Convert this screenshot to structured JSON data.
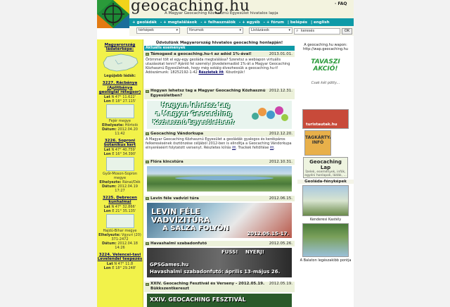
{
  "header": {
    "site_name": "geocaching.hu",
    "tagline": "A Magyar Geocaching Közhasznú Egyesület hivatalos lapja",
    "faq": "· FAQ"
  },
  "nav": {
    "items": [
      "+ geoládák",
      "- + megtalálások",
      "- + felhasználók",
      "- + egyéb",
      "- + fórum",
      "| belépés",
      "| english"
    ]
  },
  "filters": {
    "map_select": "térképek",
    "forum_select": "fórumok",
    "list_select": "Listázások",
    "search_placeholder": "keresés",
    "ok_label": "OK"
  },
  "left": {
    "header": "Magyarország ládatérképe:",
    "latest_label": "Legújabb ládák:",
    "caches": [
      {
        "title": "3227. Rácbánya (Aplitbánya geológiai rétegsor)",
        "lat": "N 47° 11.622'",
        "lon": "E 18° 27.115'",
        "county": "Fejér megye",
        "place": "Hőrtoló",
        "date": "2012.04.20 11:42"
      },
      {
        "title": "3226. Soproni botanikus kert",
        "lat": "N 47° 40.759'",
        "lon": "E 16° 34.390'",
        "county": "Győr-Moson-Sopron megye",
        "place": "Ránai/Dék",
        "date": "2012.04.19 17:27"
      },
      {
        "title": "3225. Debrecen kunhalmai",
        "lat": "N 47° 32.866'",
        "lon": "E 21° 35.135'",
        "county": "Hajdú-Bihar megye",
        "place": "Vgyuri (20) 371-2472",
        "date": "2012.04.18 14:26"
      },
      {
        "title": "3224. Velencei-tavi Levelendei teepezés",
        "lat": "N 47° 11.8 ",
        "lon": "E 18° 29.248'",
        "county": "",
        "place": "",
        "date": ""
      }
    ],
    "lat_prefix": "Lat",
    "lon_prefix": "Lon",
    "place_label": "Elhelyezte:",
    "date_label": "Dátum:"
  },
  "center": {
    "welcome": "Üdvözlünk Magyarország hivatalos geocaching honlapján!",
    "section": "Aktuális események",
    "news": [
      {
        "title": "Támogasd a geocaching.hu-t az adód 1%-ával!",
        "date": "2013.01.01.",
        "body": "Örömmel tölt el egy-egy geoláda megtalálása? Szeretsz a webiapon virtuális utazásokat tenni? Ajánld fel személyi jövedelemadód 1%-át a Magyar Geocaching Közhasznú Egyesületnek, hogy még sokáig élvezhessük a geocaching.hu-t! Adószámunk: 18252192-1-42",
        "link": "Részletek itt",
        "suffix": ". Köszönjük!"
      },
      {
        "title": "Hogyan lehetsz tag a Magyar Geocaching Közhasznú Egyesületben?",
        "date": "2012.12.31.",
        "banner1": "Hogyan lehetsz tag",
        "banner2": "a Magyar Geocaching",
        "banner3": "Közhasznú Egyesületben?"
      },
      {
        "title": "Geocaching Vándorkupa",
        "date": "2012.12.20.",
        "body": "A Magyar Geocaching Közhasznú Egyesület a geoládák gyalogos és kerékpáros felkeresésének ösztönzése céljából 2012-ben is elindítja a Geocaching Vándorkupa elnyeréséért folytatott versenyt. Részletes kiírás",
        "link": "itt",
        "suffix": ". Trackek feltöltése",
        "link2": "itt",
        "end": "."
      },
      {
        "title": "Flóra kincstúra",
        "date": "2012.10.31."
      },
      {
        "title": "Levin féle vadvízi túra",
        "date": "2012.06.15.",
        "banner1": "LEVIN FÉLE",
        "banner2": "VADVÍZITÚRA",
        "banner3": "A SALZA FOLYÓN",
        "banner4": "2012.06.15-17."
      },
      {
        "title": "Havashalmi szabadonfutó",
        "date": "2012.05.26.",
        "banner1": "FUSS!",
        "banner2": "NYERJ!",
        "banner3": "GPSGames.hu",
        "banner4": "Havashalmi szabadonfutó: április 13-május 26."
      },
      {
        "title": "XXIV. Geocaching Fesztivál és Verseny - 2012.05.19. Bükkszentkereszt",
        "date": "2012.05.19.",
        "banner1": "XXIV. GEOCACHING FESZTIVÁL"
      }
    ]
  },
  "right": {
    "wap_text": "A geocaching.hu wapon: http://wap.geocaching.hu",
    "promo1": "TAVASZI",
    "promo2": "AKCIÓ!",
    "promo_small": "Csak két pötty...",
    "turista": "turistautak.hu",
    "tagkartya": "TAGKÁRTYA",
    "info": "INFÓ",
    "lap_title": "Geocaching Lap",
    "lap_sub": "Ízelek, események, infók, egyéni honlapok, ládák, ...",
    "photos_title": "Geoláda-fényképek",
    "photo1": "Kenderesi Kastély",
    "photo2": "A Balaton legészakibb pontja"
  },
  "colors": {
    "teal": "#0e9aa7",
    "yellow": "#f2f24a"
  }
}
